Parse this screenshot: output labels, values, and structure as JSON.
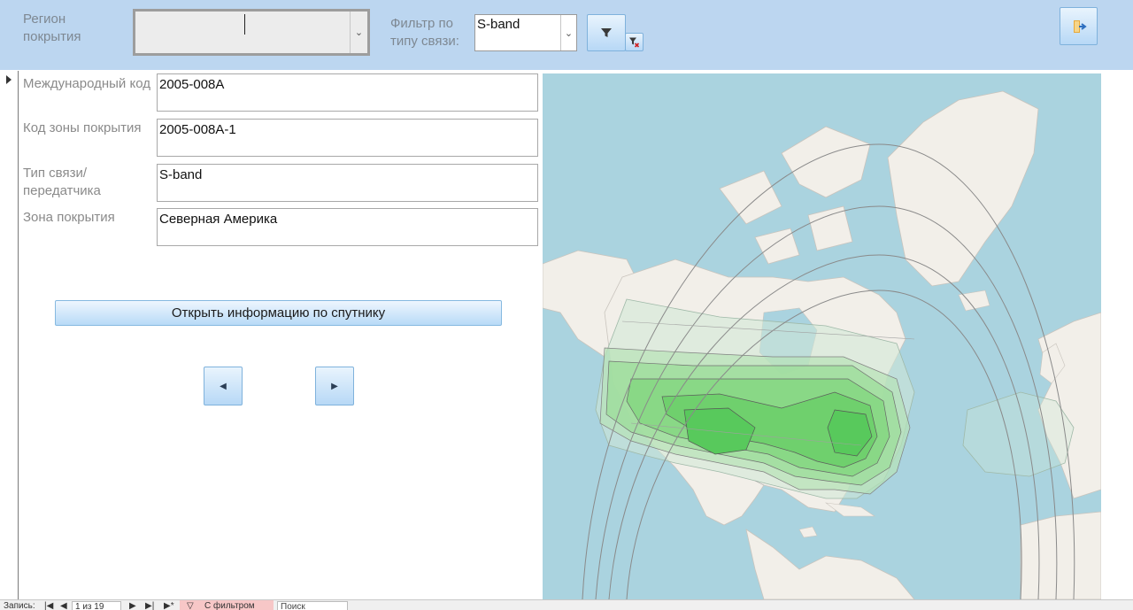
{
  "header": {
    "region_label": "Регион покрытия",
    "region_value": "",
    "type_filter_label": "Фильтр по типу связи:",
    "type_filter_value": "S-band",
    "icons": [
      "filter-icon",
      "clear-filter-icon",
      "exit-icon",
      "chevron-down-icon"
    ]
  },
  "record": {
    "intl_code_label": "Международный код",
    "intl_code_value": "2005-008A",
    "zone_code_label": "Код зоны покрытия",
    "zone_code_value": "2005-008A-1",
    "comm_type_label": "Тип связи/передатчика",
    "comm_type_value": "S-band",
    "zone_label": "Зона покрытия",
    "zone_value": "Северная Америка"
  },
  "actions": {
    "open_satellite_info": "Открыть информацию по спутнику",
    "prev_icon": "triangle-left-icon",
    "next_icon": "triangle-right-icon"
  },
  "colors": {
    "header_bg": "#bcd6f0",
    "ocean": "#aad3df",
    "land": "#f2efe9",
    "coverage": "#44cc55"
  },
  "statusbar": {
    "records_label": "Запись:",
    "record_position": "1 из 19",
    "filter_status": "С фильтром",
    "search_placeholder": "Поиск"
  }
}
